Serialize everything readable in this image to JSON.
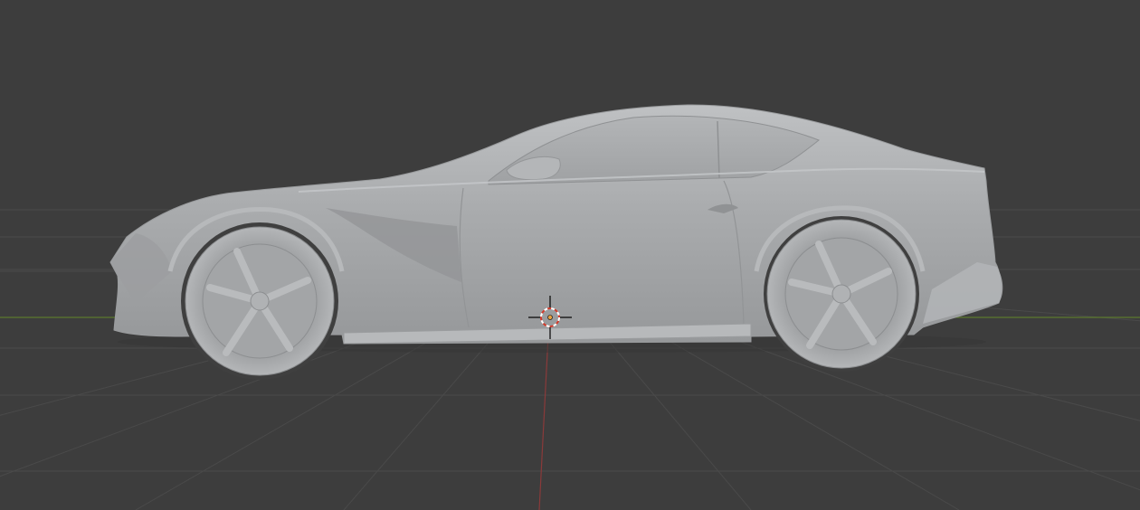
{
  "viewport": {
    "mode": "3d-viewport",
    "shading": "solid",
    "model": "sports-car",
    "view": "side"
  },
  "colors": {
    "background": "#3d3d3d",
    "grid_line": "#4a4a4a",
    "x_axis": "#8a3a3a",
    "y_axis": "#5b7a2e",
    "model_base": "#a6a8aa",
    "model_light": "#bcbec0",
    "model_shadow": "#8d8f91",
    "cursor_red": "#d23a2a",
    "cursor_white": "#ffffff"
  },
  "icons": {
    "cursor": "3d-cursor-icon",
    "origin": "object-origin-icon"
  }
}
